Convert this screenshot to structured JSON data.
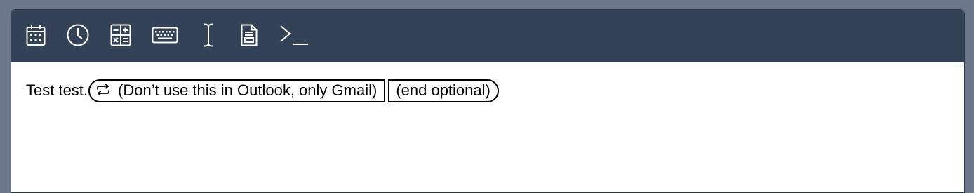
{
  "toolbar": {
    "buttons": [
      {
        "icon": "calendar-icon",
        "tooltip": "Date"
      },
      {
        "icon": "clock-icon",
        "tooltip": "Time"
      },
      {
        "icon": "calculator-icon",
        "tooltip": "Formula"
      },
      {
        "icon": "keyboard-icon",
        "tooltip": "Key press"
      },
      {
        "icon": "text-cursor-icon",
        "tooltip": "Cursor"
      },
      {
        "icon": "clipboard-document-icon",
        "tooltip": "Clipboard"
      },
      {
        "icon": "terminal-icon",
        "tooltip": "Script"
      }
    ],
    "background": "#344257",
    "icon_color": "#ffffff"
  },
  "editor": {
    "text": "Test test.",
    "optional_block": {
      "icon": "repeat-icon",
      "label": "(Don’t use this in Outlook, only Gmail)"
    },
    "end_block": {
      "label": "(end optional)"
    }
  }
}
